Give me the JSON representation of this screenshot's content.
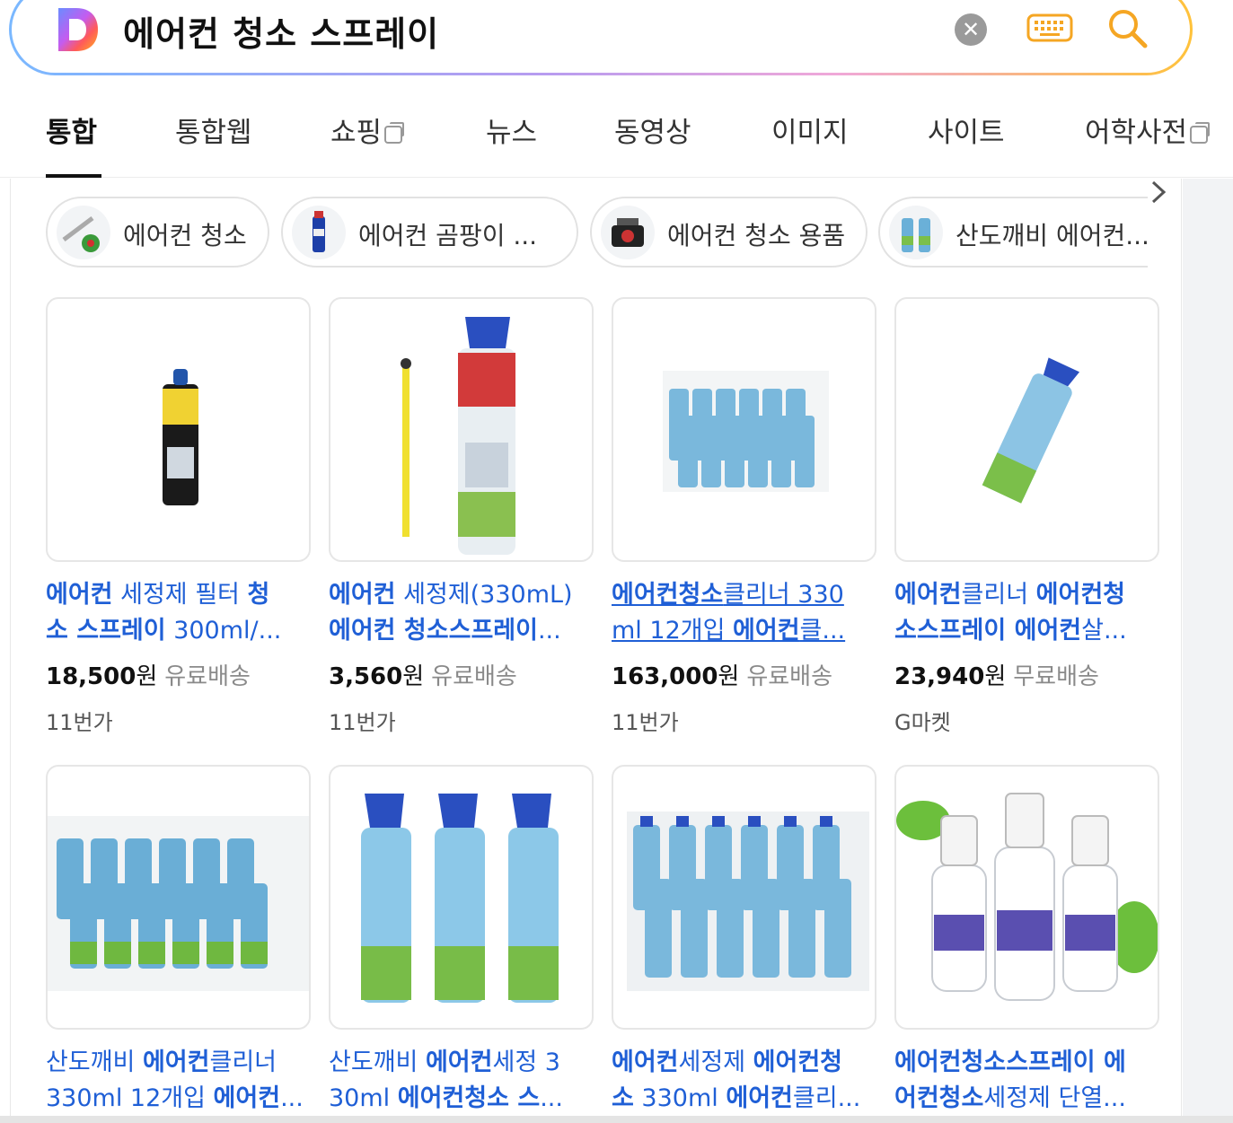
{
  "search": {
    "query": "에어컨 청소 스프레이",
    "clear_label": "✕"
  },
  "tabs": [
    {
      "label": "통합",
      "active": true,
      "external": false
    },
    {
      "label": "통합웹",
      "active": false,
      "external": false
    },
    {
      "label": "쇼핑",
      "active": false,
      "external": true
    },
    {
      "label": "뉴스",
      "active": false,
      "external": false
    },
    {
      "label": "동영상",
      "active": false,
      "external": false
    },
    {
      "label": "이미지",
      "active": false,
      "external": false
    },
    {
      "label": "사이트",
      "active": false,
      "external": false
    },
    {
      "label": "어학사전",
      "active": false,
      "external": true
    }
  ],
  "chips": [
    {
      "label": "에어컨 청소"
    },
    {
      "label": "에어컨 곰팡이 ..."
    },
    {
      "label": "에어컨 청소 용품"
    },
    {
      "label": "산도깨비 에어컨..."
    }
  ],
  "products": [
    {
      "title_line1": "에어컨 세정제 필터 청",
      "title_line2": "소 스프레이 300ml/...",
      "price": "18,500",
      "currency": "원",
      "shipping": "유료배송",
      "mall": "11번가"
    },
    {
      "title_line1": "에어컨 세정제(330mL)",
      "title_line2": "에어컨 청소스프레이...",
      "price": "3,560",
      "currency": "원",
      "shipping": "유료배송",
      "mall": "11번가"
    },
    {
      "title_line1": "에어컨청소클리너 330",
      "title_line2": "ml 12개입 에어컨클...",
      "price": "163,000",
      "currency": "원",
      "shipping": "유료배송",
      "mall": "11번가"
    },
    {
      "title_line1": "에어컨클리너 에어컨청",
      "title_line2": "소스프레이 에어컨살...",
      "price": "23,940",
      "currency": "원",
      "shipping": "무료배송",
      "mall": "G마켓"
    },
    {
      "title_line1": "산도깨비 에어컨클리너",
      "title_line2": "330ml 12개입 에어컨...",
      "price": "",
      "currency": "",
      "shipping": "",
      "mall": ""
    },
    {
      "title_line1": "산도깨비 에어컨세정 3",
      "title_line2": "30ml 에어컨청소 스...",
      "price": "",
      "currency": "",
      "shipping": "",
      "mall": ""
    },
    {
      "title_line1": "에어컨세정제 에어컨청",
      "title_line2": "소 330ml 에어컨클리...",
      "price": "",
      "currency": "",
      "shipping": "",
      "mall": ""
    },
    {
      "title_line1": "에어컨청소스프레이 에",
      "title_line2": "어컨청소세정제 단열...",
      "price": "",
      "currency": "",
      "shipping": "",
      "mall": ""
    }
  ],
  "colors": {
    "link_blue": "#1f5fd6",
    "accent_orange": "#f5a623"
  },
  "icons": {
    "logo": "daum-d-logo",
    "clear": "clear-icon",
    "keyboard": "keyboard-icon",
    "search": "search-icon",
    "next": "chevron-right-icon"
  }
}
